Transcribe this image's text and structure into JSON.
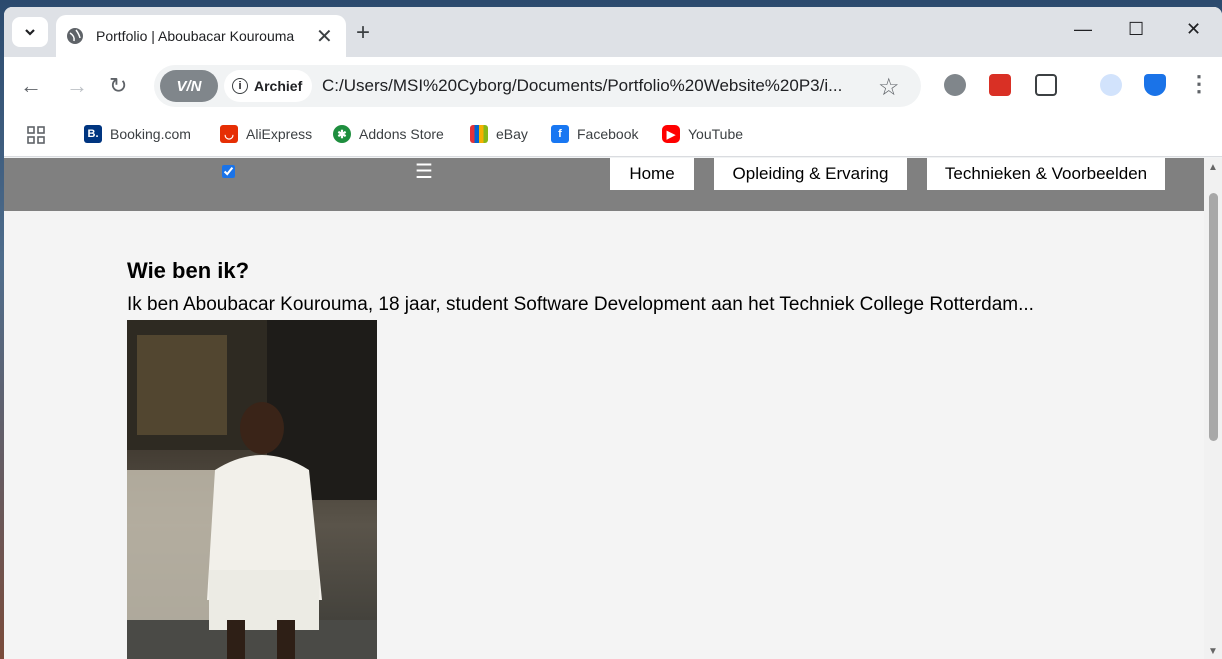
{
  "browser": {
    "tab_title": "Portfolio | Aboubacar Kourouma",
    "vpn_label": "V/N",
    "archief_label": "Archief",
    "url": "C:/Users/MSI%20Cyborg/Documents/Portfolio%20Website%20P3/i...",
    "bookmarks": [
      {
        "label": "Booking.com",
        "icon": "booking-icon",
        "color": "#003580"
      },
      {
        "label": "AliExpress",
        "icon": "aliexpress-icon",
        "color": "#e62e04"
      },
      {
        "label": "Addons Store",
        "icon": "addons-icon",
        "color": "#1e8e3e"
      },
      {
        "label": "eBay",
        "icon": "ebay-icon",
        "color": "#e53238"
      },
      {
        "label": "Facebook",
        "icon": "facebook-icon",
        "color": "#1877f2"
      },
      {
        "label": "YouTube",
        "icon": "youtube-icon",
        "color": "#ff0000"
      }
    ]
  },
  "site": {
    "nav": [
      "Home",
      "Opleiding & Ervaring",
      "Technieken & Voorbeelden"
    ],
    "menu_icon": "☰",
    "heading": "Wie ben ik?",
    "intro": "Ik ben Aboubacar Kourouma, 18 jaar, student Software Development aan het Techniek College Rotterdam..."
  }
}
